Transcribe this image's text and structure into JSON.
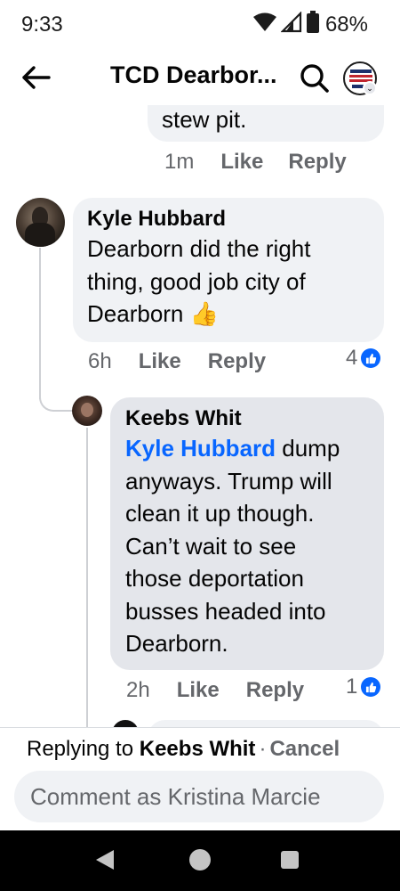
{
  "status_bar": {
    "time": "9:33",
    "battery": "68%"
  },
  "header": {
    "title": "TCD Dearbor..."
  },
  "icons": {
    "back": "arrow-left-icon",
    "search": "search-icon",
    "group": "group-avatar-icon",
    "like": "thumbs-up-icon"
  },
  "colors": {
    "link": "#0866ff",
    "muted": "#65676b",
    "bubble": "#f0f2f5",
    "bubble_selected": "#e4e6eb"
  },
  "comments": [
    {
      "body": "stew pit.",
      "time": "1m",
      "like_label": "Like",
      "reply_label": "Reply"
    },
    {
      "author": "Kyle Hubbard",
      "body_lines": [
        "Dearborn did the right",
        "thing, good job city of",
        "Dearborn"
      ],
      "emoji": "👍",
      "time": "6h",
      "like_label": "Like",
      "reply_label": "Reply",
      "reaction_count": "4"
    },
    {
      "author": "Keebs Whit",
      "mention": "Kyle Hubbard",
      "body_first": " dump",
      "body_lines": [
        "anyways. Trump will",
        "clean it up though.",
        "Can’t wait to see",
        "those deportation",
        "busses headed into",
        "Dearborn."
      ],
      "time": "2h",
      "like_label": "Like",
      "reply_label": "Reply",
      "reaction_count": "1"
    }
  ],
  "composer": {
    "replying_prefix": "Replying to",
    "replying_to": "Keebs Whit",
    "separator": "·",
    "cancel_label": "Cancel",
    "placeholder": "Comment as Kristina Marcie"
  }
}
